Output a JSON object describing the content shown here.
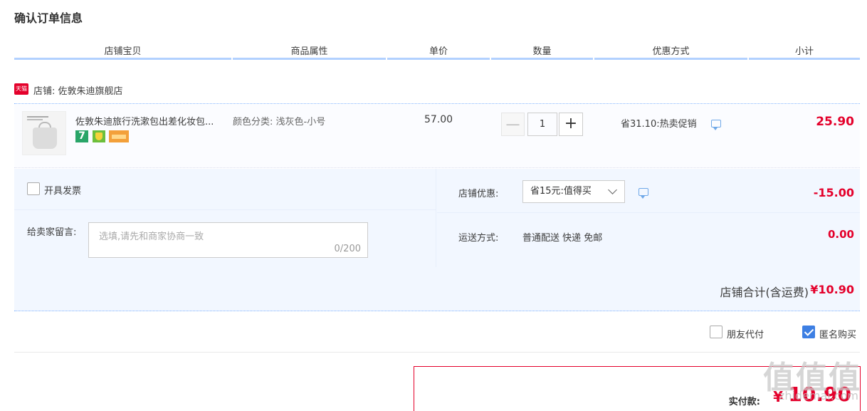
{
  "page": {
    "title": "确认订单信息"
  },
  "table_headers": [
    "店铺宝贝",
    "商品属性",
    "单价",
    "数量",
    "优惠方式",
    "小计"
  ],
  "shop": {
    "badge": "天猫",
    "name": "店铺: 佐敦朱迪旗舰店"
  },
  "item": {
    "title": "佐敦朱迪旅行洗漱包出差化妆包...",
    "attribute": "颜色分类: 浅灰色-小号",
    "unit_price": "57.00",
    "quantity": "1",
    "minus": "—",
    "plus": "+",
    "promo": "省31.10:热卖促销",
    "subtotal": "25.90",
    "service_icons": [
      "seven-day-return-icon",
      "guarantee-shield-icon",
      "credit-card-icon"
    ]
  },
  "invoice": {
    "label": "开具发票",
    "checked": false
  },
  "message": {
    "label": "给卖家留言:",
    "placeholder": "选填,请先和商家协商一致",
    "count": "0/200"
  },
  "shop_coupon": {
    "label": "店铺优惠:",
    "selected": "省15元:值得买",
    "amount": "-15.00"
  },
  "shipping": {
    "label": "运送方式:",
    "method": "普通配送 快递 免邮",
    "amount": "0.00"
  },
  "shop_total": {
    "label": "店铺合计(含运费)",
    "value": "¥10.90"
  },
  "extras": {
    "friend_pay": "朋友代付",
    "friend_pay_checked": false,
    "anonymous": "匿名购买",
    "anonymous_checked": true
  },
  "payment": {
    "label": "实付款:",
    "currency": "¥",
    "value": "10.90"
  },
  "watermark": {
    "main": "值值值",
    "sub": "zhidemai.com"
  },
  "colors": {
    "accent_red": "#e4002b",
    "header_line": "#b2d1ff",
    "panel_bg": "#f2f7ff",
    "check_blue": "#3d7fe3"
  }
}
